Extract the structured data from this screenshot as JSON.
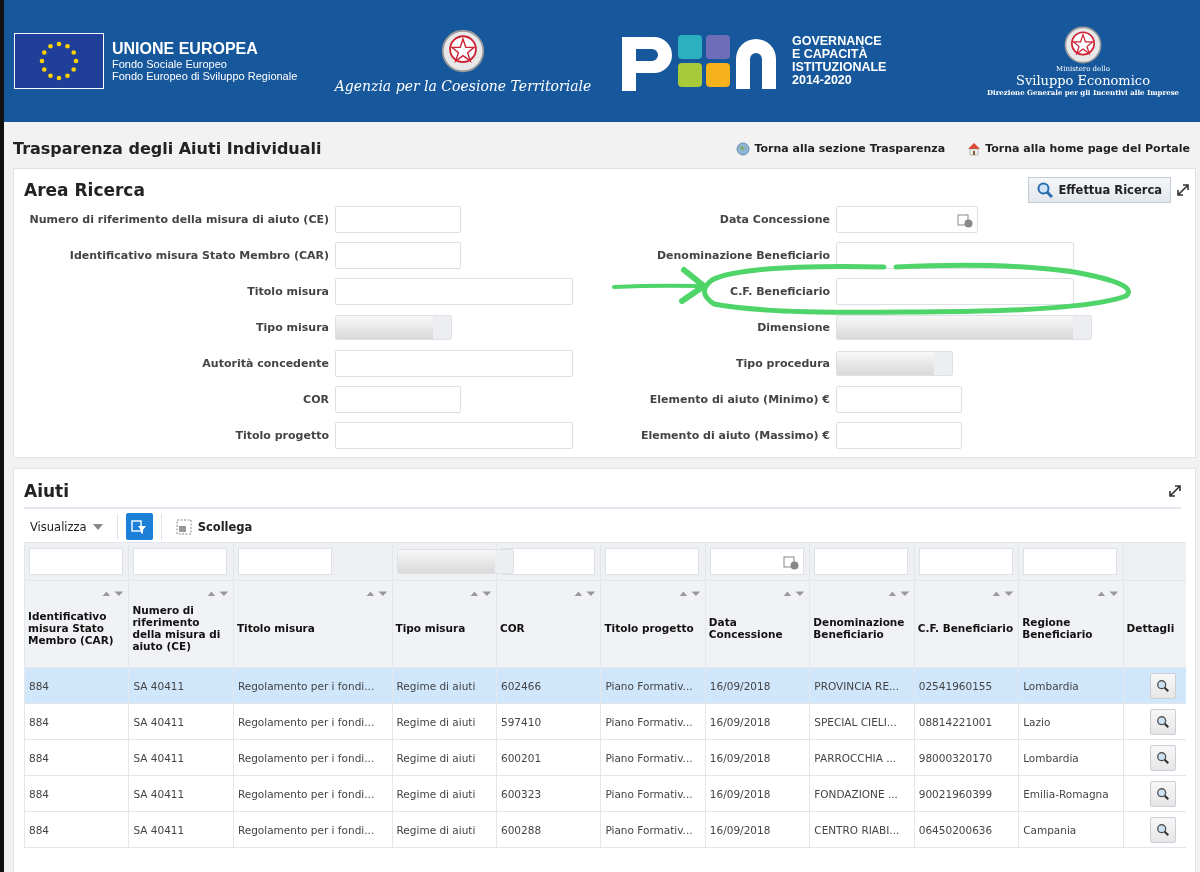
{
  "header": {
    "eu": {
      "title": "UNIONE EUROPEA",
      "lines": [
        "Fondo Sociale Europeo",
        "Fondo Europeo di Sviluppo Regionale"
      ]
    },
    "agency": "Agenzia per la Coesione Territoriale",
    "pon": {
      "lines": [
        "GOVERNANCE",
        "E CAPACITÀ",
        "ISTITUZIONALE",
        "2014-2020"
      ]
    },
    "ministry": {
      "small": "Ministero dello",
      "name": "Sviluppo Economico",
      "sub": "Direzione Generale per gli Incentivi alle Imprese"
    }
  },
  "page_title": "Trasparenza degli Aiuti Individuali",
  "links": [
    {
      "label": "Torna alla sezione Trasparenza",
      "kind": "globe"
    },
    {
      "label": "Torna alla home page del Portale",
      "kind": "home"
    }
  ],
  "search": {
    "title": "Area Ricerca",
    "button": "Effettua Ricerca",
    "left_fields": [
      {
        "label": "Numero di riferimento della misura di aiuto (CE)",
        "kind": "short"
      },
      {
        "label": "Identificativo misura Stato Membro (CAR)",
        "kind": "short"
      },
      {
        "label": "Titolo misura",
        "kind": "long"
      },
      {
        "label": "Tipo misura",
        "kind": "select"
      },
      {
        "label": "Autorità concedente",
        "kind": "long"
      },
      {
        "label": "COR",
        "kind": "short"
      },
      {
        "label": "Titolo progetto",
        "kind": "long"
      }
    ],
    "right_fields": [
      {
        "label": "Data Concessione",
        "kind": "date"
      },
      {
        "label": "Denominazione Beneficiario",
        "kind": "long"
      },
      {
        "label": "C.F. Beneficiario",
        "kind": "long"
      },
      {
        "label": "Dimensione",
        "kind": "wideselect"
      },
      {
        "label": "Tipo procedura",
        "kind": "select"
      },
      {
        "label": "Elemento di aiuto (Minimo) €",
        "kind": "short"
      },
      {
        "label": "Elemento di aiuto (Massimo) €",
        "kind": "short"
      }
    ]
  },
  "results": {
    "title": "Aiuti",
    "toolbar": {
      "view_menu": "Visualizza",
      "detach": "Scollega"
    },
    "columns": [
      {
        "label": "Identificativo misura Stato Membro (CAR)",
        "kind": "text",
        "sortable": true
      },
      {
        "label": "Numero di riferimento della misura di aiuto (CE)",
        "kind": "text",
        "sortable": true
      },
      {
        "label": "Titolo misura",
        "kind": "text",
        "sortable": true
      },
      {
        "label": "Tipo misura",
        "kind": "select",
        "sortable": true
      },
      {
        "label": "COR",
        "kind": "text",
        "sortable": true
      },
      {
        "label": "Titolo progetto",
        "kind": "text",
        "sortable": true
      },
      {
        "label": "Data Concessione",
        "kind": "date",
        "sortable": true
      },
      {
        "label": "Denominazione Beneficiario",
        "kind": "text",
        "sortable": true
      },
      {
        "label": "C.F. Beneficiario",
        "kind": "text",
        "sortable": true
      },
      {
        "label": "Regione Beneficiario",
        "kind": "text",
        "sortable": true
      },
      {
        "label": "Dettagli",
        "kind": "action",
        "sortable": false
      }
    ],
    "rows": [
      {
        "selected": true,
        "cells": [
          "884",
          "SA 40411",
          "Regolamento per i fondi...",
          "Regime di aiuti",
          "602466",
          "Piano Formativ...",
          "16/09/2018",
          "PROVINCIA RE...",
          "02541960155",
          "Lombardia"
        ]
      },
      {
        "selected": false,
        "cells": [
          "884",
          "SA 40411",
          "Regolamento per i fondi...",
          "Regime di aiuti",
          "597410",
          "Piano Formativ...",
          "16/09/2018",
          "SPECIAL CIELI...",
          "08814221001",
          "Lazio"
        ]
      },
      {
        "selected": false,
        "cells": [
          "884",
          "SA 40411",
          "Regolamento per i fondi...",
          "Regime di aiuti",
          "600201",
          "Piano Formativ...",
          "16/09/2018",
          "PARROCCHIA ...",
          "98000320170",
          "Lombardia"
        ]
      },
      {
        "selected": false,
        "cells": [
          "884",
          "SA 40411",
          "Regolamento per i fondi...",
          "Regime di aiuti",
          "600323",
          "Piano Formativ...",
          "16/09/2018",
          "FONDAZIONE ...",
          "90021960399",
          "Emilia-Romagna"
        ]
      },
      {
        "selected": false,
        "cells": [
          "884",
          "SA 40411",
          "Regolamento per i fondi...",
          "Regime di aiuti",
          "600288",
          "Piano Formativ...",
          "16/09/2018",
          "CENTRO RIABI...",
          "06450200636",
          "Campania"
        ]
      }
    ]
  }
}
